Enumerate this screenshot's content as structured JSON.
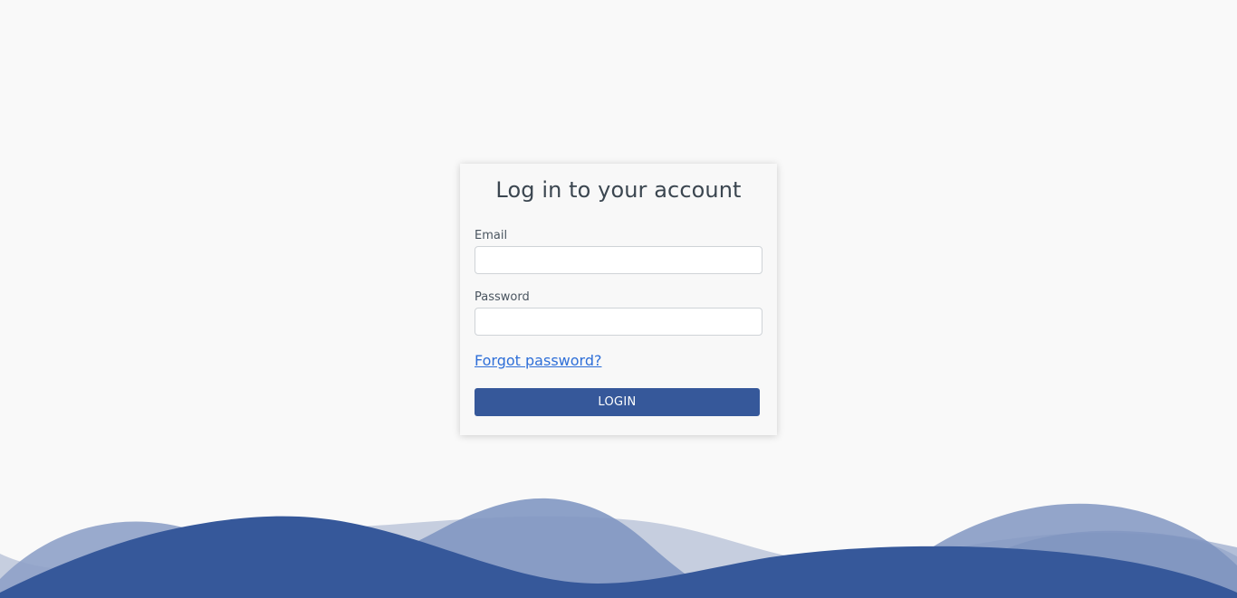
{
  "login_card": {
    "title": "Log in to your account",
    "email_label": "Email",
    "email_value": "",
    "password_label": "Password",
    "password_value": "",
    "forgot_password_link": "Forgot password?",
    "login_button": "LOGIN"
  },
  "colors": {
    "background": "#f9f9f9",
    "accent": "#36589a",
    "link": "#2f6fd8",
    "wave_light": "#c6cedf",
    "wave_medium": "#8197c2"
  }
}
